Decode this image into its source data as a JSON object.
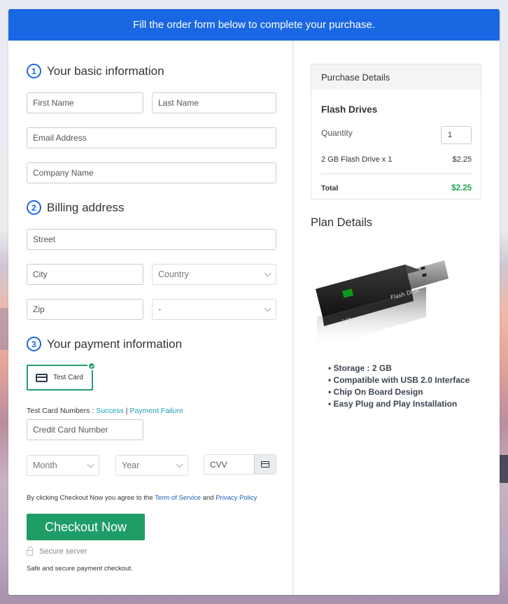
{
  "banner": {
    "text": "Fill the order form below to complete your purchase."
  },
  "sections": {
    "basic": {
      "number": "1",
      "title": "Your basic information"
    },
    "billing": {
      "number": "2",
      "title": "Billing address"
    },
    "payment": {
      "number": "3",
      "title": "Your payment information"
    }
  },
  "fields": {
    "first_name": {
      "placeholder": "First Name",
      "value": ""
    },
    "last_name": {
      "placeholder": "Last Name",
      "value": ""
    },
    "email": {
      "placeholder": "Email Address",
      "value": ""
    },
    "company": {
      "placeholder": "Company Name",
      "value": ""
    },
    "street": {
      "placeholder": "Street",
      "value": ""
    },
    "city": {
      "placeholder": "City",
      "value": ""
    },
    "country": {
      "selected": "Country"
    },
    "zip": {
      "placeholder": "Zip",
      "value": ""
    },
    "state": {
      "selected": "-"
    },
    "card_number": {
      "placeholder": "Credit Card Number",
      "value": ""
    },
    "month": {
      "selected": "Month"
    },
    "year": {
      "selected": "Year"
    },
    "cvv": {
      "placeholder": "CVV",
      "value": ""
    }
  },
  "payment": {
    "method_label": "Test Card",
    "method_selected": true,
    "test_numbers_label": "Test Card Numbers : ",
    "success_link": "Success",
    "separator": " | ",
    "failure_link": "Payment Failure"
  },
  "agreement": {
    "prefix": "By clicking Checkout Now you agree to the ",
    "tos_link": "Term of Service",
    "and": " and ",
    "privacy_link": "Privacy Policy"
  },
  "checkout": {
    "button_label": "Checkout Now",
    "secure_label": "Secure server",
    "safe_note": "Safe and secure payment checkout."
  },
  "purchase": {
    "header": "Purchase Details",
    "product": "Flash Drives",
    "quantity_label": "Quantity",
    "quantity": "1",
    "line_item": "2 GB Flash Drive x 1",
    "line_price": "$2.25",
    "total_label": "Total",
    "total_amount": "$2.25"
  },
  "plan": {
    "title": "Plan Details",
    "image_labels": {
      "brand": "Flash DISK",
      "capacity": "2 Gb"
    },
    "features": [
      "Storage : 2 GB",
      "Compatible with USB 2.0 Interface",
      "Chip On Board Design",
      "Easy Plug and Play Installation"
    ]
  },
  "colors": {
    "primary": "#1a67e3",
    "success": "#1e9e66",
    "total_green": "#22a650",
    "link_teal": "#1aa0b5",
    "link_blue": "#1a5fb4"
  }
}
